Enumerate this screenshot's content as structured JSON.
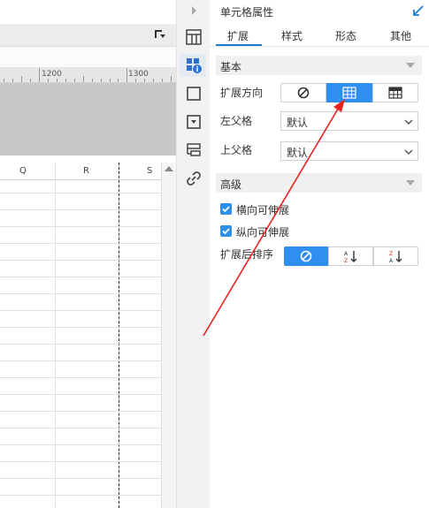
{
  "sheet": {
    "ruler_labels": [
      "1200",
      "1300"
    ],
    "columns": [
      "Q",
      "R",
      "S"
    ]
  },
  "panel": {
    "title": "单元格属性",
    "tabs": [
      {
        "label": "扩展",
        "active": true
      },
      {
        "label": "样式",
        "active": false
      },
      {
        "label": "形态",
        "active": false
      },
      {
        "label": "其他",
        "active": false
      }
    ],
    "basic_section": "基本",
    "expand_direction_label": "扩展方向",
    "expand_direction_selected": "vertical",
    "left_parent_label": "左父格",
    "left_parent_value": "默认",
    "upper_parent_label": "上父格",
    "upper_parent_value": "默认",
    "advanced_section": "高级",
    "horizontal_expandable_label": "横向可伸展",
    "horizontal_expandable_checked": true,
    "vertical_expandable_label": "纵向可伸展",
    "vertical_expandable_checked": true,
    "sort_after_expand_label": "扩展后排序",
    "sort_selected": "none"
  },
  "colors": {
    "accent": "#2f8ff0",
    "tab_underline": "#1e7bd6",
    "annotation_arrow": "#e8231f"
  }
}
